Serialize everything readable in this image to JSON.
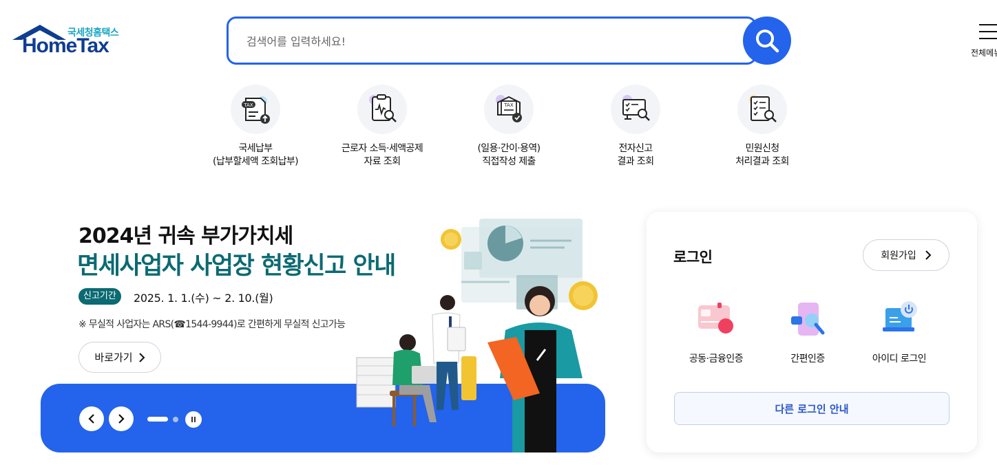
{
  "header": {
    "logo_sub": "국세청홈택스",
    "logo_main": "HomeTax",
    "search_placeholder": "검색어를 입력하세요!",
    "menu_label": "전체메뉴"
  },
  "quick_links": [
    {
      "line1": "국세납부",
      "line2": "(납부할세액 조회납부)",
      "icon": "tax-payment-icon"
    },
    {
      "line1": "근로자 소득·세액공제",
      "line2": "자료 조회",
      "icon": "deduction-document-icon"
    },
    {
      "line1": "(일용·간이·용역)",
      "line2": "직접작성 제출",
      "icon": "tax-submit-icon"
    },
    {
      "line1": "전자신고",
      "line2": "결과 조회",
      "icon": "e-filing-result-icon"
    },
    {
      "line1": "민원신청",
      "line2": "처리결과 조회",
      "icon": "civil-request-icon"
    }
  ],
  "banner": {
    "title_line1": "2024년 귀속 부가가치세",
    "title_line2": "면세사업자 사업장 현황신고 안내",
    "period_badge": "신고기간",
    "period_text": "2025. 1. 1.(수) ~ 2. 10.(월)",
    "note": "※ 무실적 사업자는 ARS(☎1544-9944)로 간편하게 무실적 신고가능",
    "go_label": "바로가기"
  },
  "login": {
    "title": "로그인",
    "join_label": "회원가입",
    "options": [
      {
        "label": "공동·금융인증",
        "icon": "certificate-card-icon"
      },
      {
        "label": "간편인증",
        "icon": "simple-auth-icon"
      },
      {
        "label": "아이디 로그인",
        "icon": "id-login-icon"
      }
    ],
    "other_label": "다른 로그인 안내"
  },
  "colors": {
    "primary_blue": "#2463eb",
    "teal": "#0b6a72",
    "logo_navy": "#0f3d91"
  }
}
